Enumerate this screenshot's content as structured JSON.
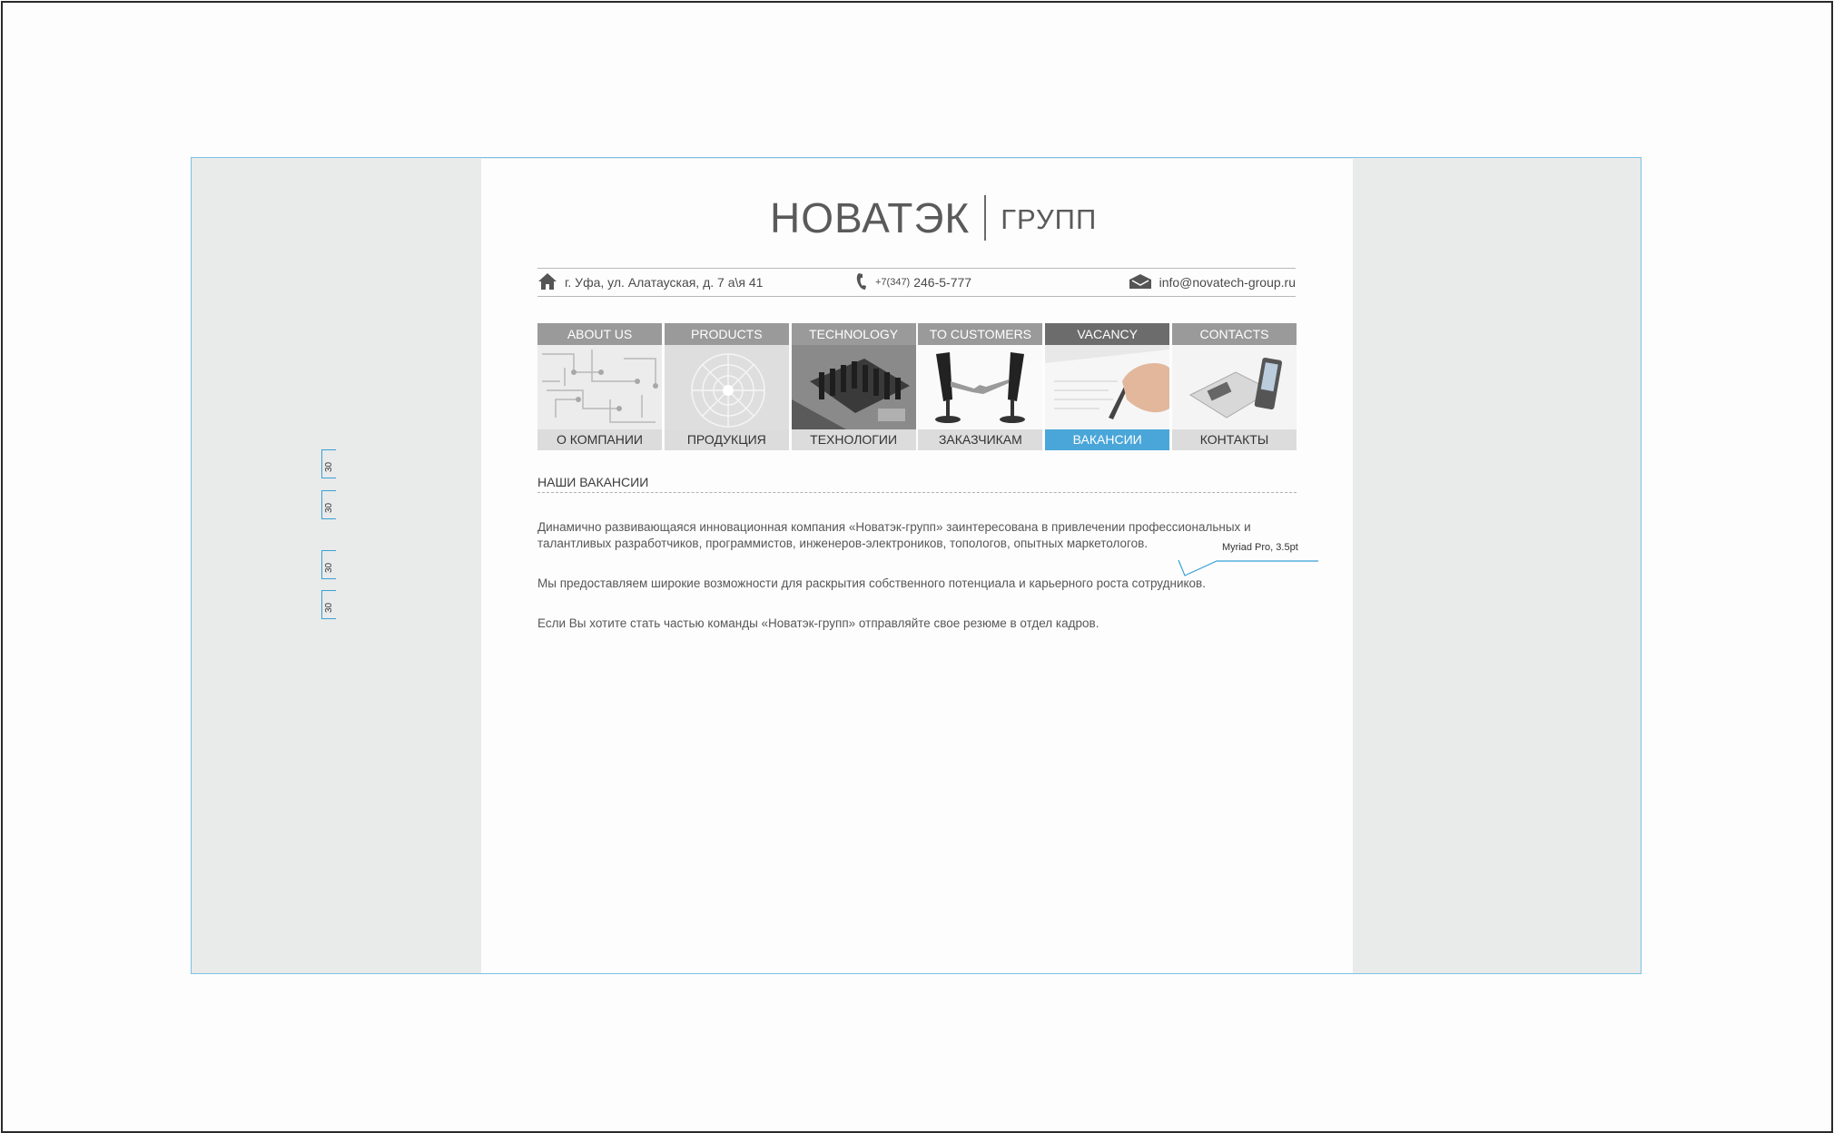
{
  "logo": {
    "name": "НОВАТЭК",
    "suffix": "ГРУПП"
  },
  "contacts": {
    "address": "г. Уфа, ул. Алатауская, д. 7 а\\я 41",
    "phone_code": "+7(347)",
    "phone": "246-5-777",
    "email": "info@novatech-group.ru"
  },
  "nav": [
    {
      "en": "ABOUT US",
      "ru": "О КОМПАНИИ"
    },
    {
      "en": "PRODUCTS",
      "ru": "ПРОДУКЦИЯ"
    },
    {
      "en": "TECHNOLOGY",
      "ru": "ТЕХНОЛОГИИ"
    },
    {
      "en": "TO CUSTOMERS",
      "ru": "ЗАКАЗЧИКАМ"
    },
    {
      "en": "VACANCY",
      "ru": "ВАКАНСИИ"
    },
    {
      "en": "CONTACTS",
      "ru": "КОНТАКТЫ"
    }
  ],
  "active_nav": "VACANCY",
  "section_title": "НАШИ ВАКАНСИИ",
  "paragraphs": [
    "Динамично развивающаяся инновационная компания «Новатэк-групп» заинтересована в привлечении профессиональных и талантливых разработчиков, программистов, инженеров-электроников, топологов, опытных маркетологов.",
    "Мы предоставляем широкие возможности для раскрытия собственного потенциала и карьерного роста сотрудников.",
    "Если Вы хотите стать частью команды «Новатэк-групп» отправляйте свое резюме в отдел кадров."
  ],
  "annotations": {
    "spacing": [
      "30",
      "30",
      "30",
      "30"
    ],
    "font_note": "Myriad Pro, 3.5pt"
  },
  "colors": {
    "accent": "#4aa6d8",
    "nav_bar": "#9a9a9a",
    "nav_active": "#6c6c6c",
    "guide": "#3aa0d6"
  }
}
